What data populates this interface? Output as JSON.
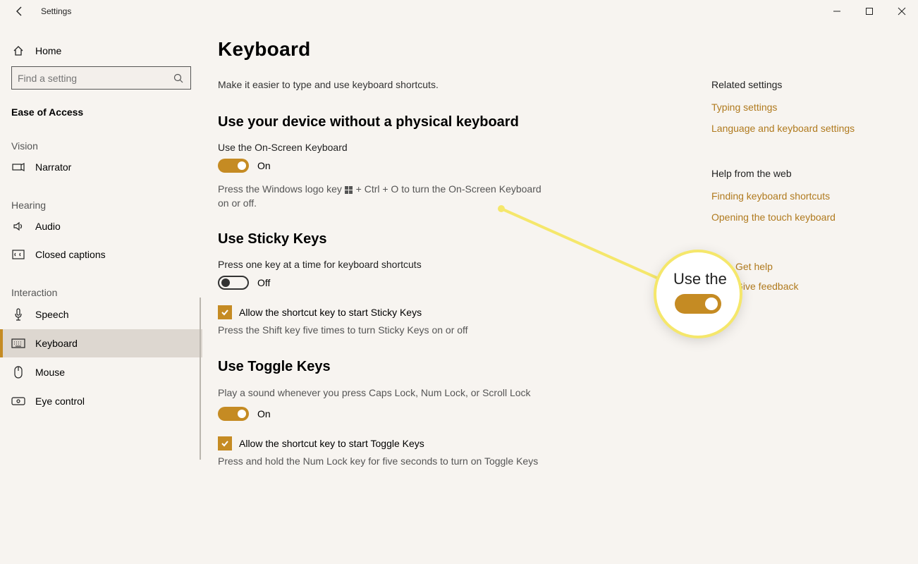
{
  "window": {
    "title": "Settings"
  },
  "sidebar": {
    "home": "Home",
    "search_placeholder": "Find a setting",
    "category": "Ease of Access",
    "groups": [
      {
        "label": "Vision",
        "items": [
          {
            "name": "Narrator"
          }
        ]
      },
      {
        "label": "Hearing",
        "items": [
          {
            "name": "Audio"
          },
          {
            "name": "Closed captions"
          }
        ]
      },
      {
        "label": "Interaction",
        "items": [
          {
            "name": "Speech"
          },
          {
            "name": "Keyboard",
            "selected": true
          },
          {
            "name": "Mouse"
          },
          {
            "name": "Eye control"
          }
        ]
      }
    ]
  },
  "main": {
    "title": "Keyboard",
    "subtitle": "Make it easier to type and use keyboard shortcuts.",
    "sections": [
      {
        "heading": "Use your device without a physical keyboard",
        "label": "Use the On-Screen Keyboard",
        "toggle_on": true,
        "state": "On",
        "hint_prefix": "Press the Windows logo key ",
        "hint_suffix": " + Ctrl + O to turn the On-Screen Keyboard on or off."
      },
      {
        "heading": "Use Sticky Keys",
        "label": "Press one key at a time for keyboard shortcuts",
        "toggle_on": false,
        "state": "Off",
        "check_label": "Allow the shortcut key to start Sticky Keys",
        "check_hint": "Press the Shift key five times to turn Sticky Keys on or off"
      },
      {
        "heading": "Use Toggle Keys",
        "label": "Play a sound whenever you press Caps Lock, Num Lock, or Scroll Lock",
        "toggle_on": true,
        "state": "On",
        "check_label": "Allow the shortcut key to start Toggle Keys",
        "check_hint": "Press and hold the Num Lock key for five seconds to turn on Toggle Keys"
      }
    ]
  },
  "right": {
    "related_heading": "Related settings",
    "related_links": [
      "Typing settings",
      "Language and keyboard settings"
    ],
    "web_heading": "Help from the web",
    "web_links": [
      "Finding keyboard shortcuts",
      "Opening the touch keyboard"
    ],
    "help": "Get help",
    "feedback": "Give feedback"
  },
  "callout": {
    "text": "Use the"
  }
}
